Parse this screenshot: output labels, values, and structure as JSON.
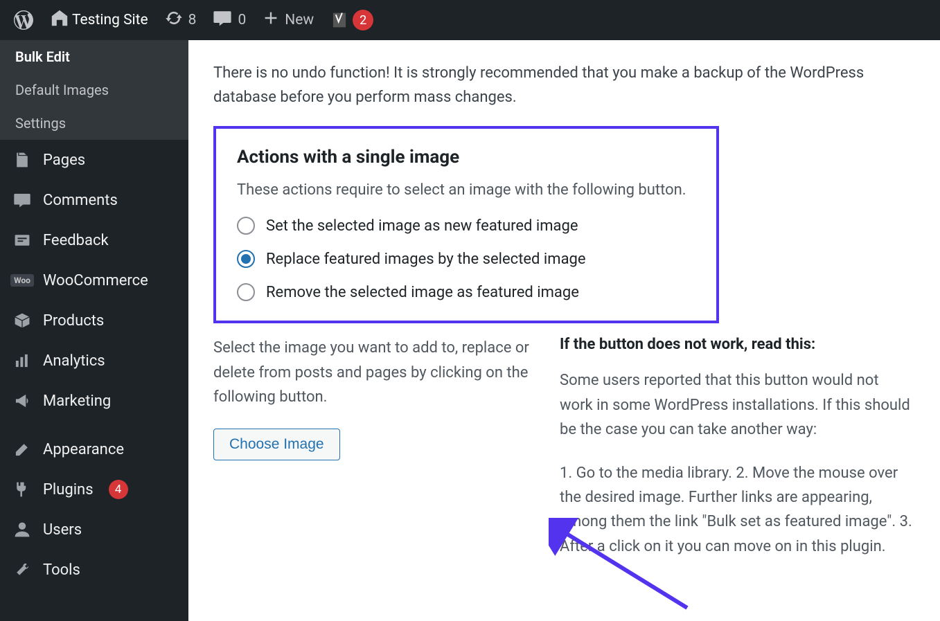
{
  "adminbar": {
    "site_name": "Testing Site",
    "updates_count": "8",
    "comments_count": "0",
    "new_label": "New",
    "yoast_count": "2"
  },
  "sidebar": {
    "submenu": [
      {
        "label": "Bulk Edit",
        "current": true
      },
      {
        "label": "Default Images",
        "current": false
      },
      {
        "label": "Settings",
        "current": false
      }
    ],
    "items": [
      {
        "name": "pages",
        "label": "Pages"
      },
      {
        "name": "comments",
        "label": "Comments"
      },
      {
        "name": "feedback",
        "label": "Feedback"
      },
      {
        "name": "woocommerce",
        "label": "WooCommerce"
      },
      {
        "name": "products",
        "label": "Products"
      },
      {
        "name": "analytics",
        "label": "Analytics"
      },
      {
        "name": "marketing",
        "label": "Marketing"
      },
      {
        "name": "appearance",
        "label": "Appearance"
      },
      {
        "name": "plugins",
        "label": "Plugins",
        "badge": "4"
      },
      {
        "name": "users",
        "label": "Users"
      },
      {
        "name": "tools",
        "label": "Tools"
      }
    ]
  },
  "content": {
    "warning": "There is no undo function! It is strongly recommended that you make a backup of the WordPress database before you perform mass changes.",
    "box_title": "Actions with a single image",
    "box_desc": "These actions require to select an image with the following button.",
    "radios": [
      {
        "label": "Set the selected image as new featured image",
        "checked": false
      },
      {
        "label": "Replace featured images by the selected image",
        "checked": true
      },
      {
        "label": "Remove the selected image as featured image",
        "checked": false
      }
    ],
    "left_text": "Select the image you want to add to, replace or delete from posts and pages by clicking on the following button.",
    "choose_button": "Choose Image",
    "right_heading": "If the button does not work, read this:",
    "right_p1": "Some users reported that this button would not work in some WordPress installations. If this should be the case you can take another way:",
    "right_p2": "1. Go to the media library. 2. Move the mouse over the desired image. Further links are appearing, among them the link \"Bulk set as featured image\". 3. After a click on it you can move on in this plugin."
  }
}
